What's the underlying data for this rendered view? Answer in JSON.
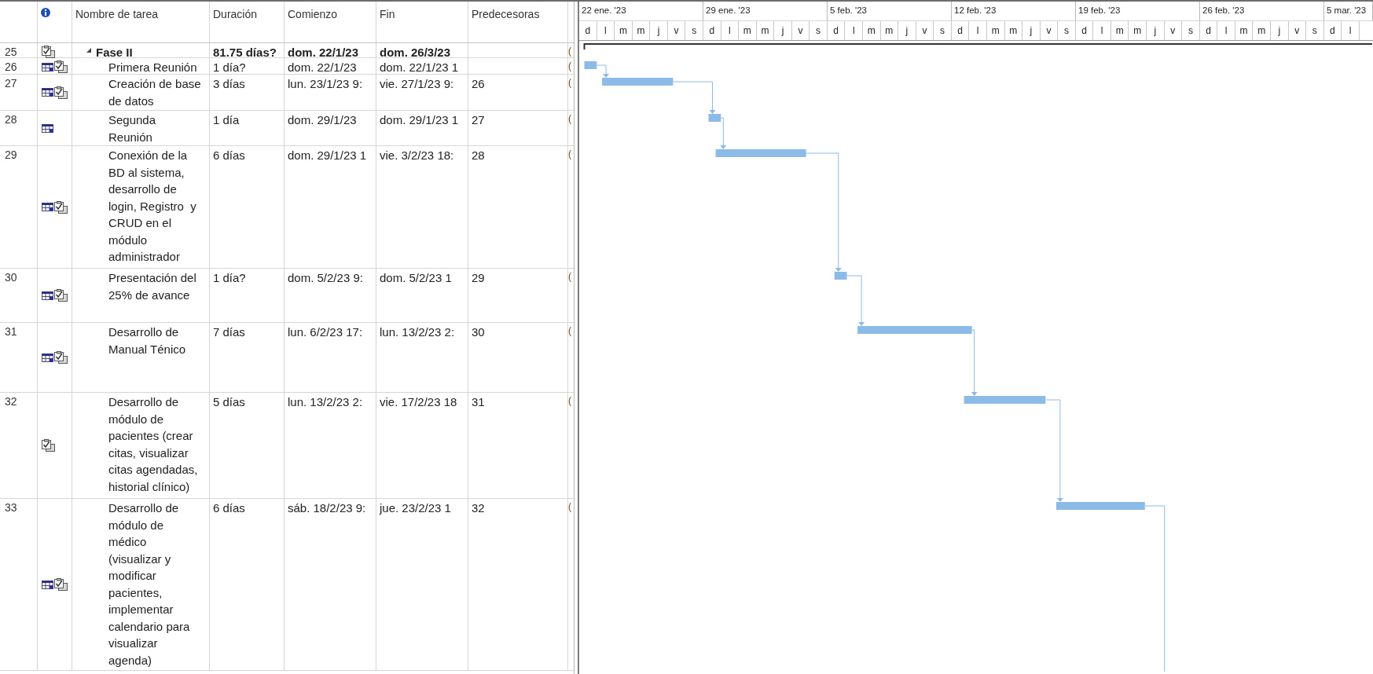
{
  "columns": [
    "Nombre de tarea",
    "Duración",
    "Comienzo",
    "Fin",
    "Predecesoras"
  ],
  "tasks": [
    {
      "id": "25",
      "name": "Fase II",
      "duracion": "81.75 días?",
      "comienzo": "dom. 22/1/23",
      "fin": "dom. 26/3/23",
      "column_8": "(",
      "calendar": false,
      "checkmark": true,
      "expanded": true,
      "children": [
        {
          "id": "26",
          "name": "Primera Reunión",
          "duracion": "1 día?",
          "comienzo": "dom. 22/1/23",
          "fin": "dom. 22/1/23 1",
          "column_8": "(",
          "calendar": true,
          "checkmark": true
        },
        {
          "id": "27",
          "name": "Creación de base de datos",
          "duracion": "3 días",
          "comienzo": "lun. 23/1/23 9:",
          "fin": "vie. 27/1/23 9:",
          "predecesoras": "26",
          "column_8": "(",
          "calendar": true,
          "checkmark": true
        },
        {
          "id": "28",
          "name": "Segunda Reunión",
          "duracion": "1 día",
          "comienzo": "dom. 29/1/23",
          "fin": "dom. 29/1/23 1",
          "predecesoras": "27",
          "column_8": "(",
          "calendar": true,
          "checkmark": false
        },
        {
          "id": "29",
          "name": "Conexión de la BD al sistema, desarrollo de login, Registro  y CRUD en el módulo administrador",
          "duracion": "6 días",
          "comienzo": "dom. 29/1/23 1",
          "fin": "vie. 3/2/23 18:",
          "predecesoras": "28",
          "column_8": "(",
          "calendar": true,
          "checkmark": true
        },
        {
          "id": "30",
          "name": "Presentación del 25% de avance",
          "duracion": "1 día?",
          "comienzo": "dom. 5/2/23 9:",
          "fin": "dom. 5/2/23 1",
          "predecesoras": "29",
          "column_8": "(",
          "calendar": true,
          "checkmark": true
        },
        {
          "id": "31",
          "name": "Desarrollo de Manual Ténico",
          "duracion": "7 días",
          "comienzo": "lun. 6/2/23 17:",
          "fin": "lun. 13/2/23 2:",
          "predecesoras": "30",
          "column_8": "(",
          "calendar": true,
          "checkmark": true
        },
        {
          "id": "32",
          "name": "Desarrollo de módulo de pacientes (crear citas, visualizar citas agendadas, historial clínico)",
          "duracion": "5 días",
          "comienzo": "lun. 13/2/23 2:",
          "fin": "vie. 17/2/23 18",
          "predecesoras": "31",
          "column_8": "(",
          "calendar": false,
          "checkmark": true
        },
        {
          "id": "33",
          "name": "Desarrollo de módulo de médico (visualizar y modificar pacientes, implementar calendario para visualizar agenda)",
          "duracion": "6 días",
          "comienzo": "sáb. 18/2/23 9:",
          "fin": "jue. 23/2/23 1",
          "predecesoras": "32",
          "column_8": "(",
          "calendar": true,
          "checkmark": true
        }
      ]
    }
  ],
  "timescale": [
    {
      "label": "22 ene. '23",
      "days": [
        "d",
        "l",
        "m",
        "m",
        "j",
        "v",
        "s"
      ]
    },
    {
      "label": "29 ene. '23",
      "days": [
        "d",
        "l",
        "m",
        "m",
        "j",
        "v",
        "s"
      ]
    },
    {
      "label": "5 feb. '23",
      "days": [
        "d",
        "l",
        "m",
        "m",
        "j",
        "v",
        "s"
      ]
    },
    {
      "label": "12 feb. '23",
      "days": [
        "d",
        "l",
        "m",
        "m",
        "j",
        "v",
        "s"
      ]
    },
    {
      "label": "19 feb. '23",
      "days": [
        "d",
        "l",
        "m",
        "m",
        "j",
        "v",
        "s"
      ]
    },
    {
      "label": "26 feb. '23",
      "days": [
        "d",
        "l",
        "m",
        "m",
        "j",
        "v",
        "s"
      ]
    },
    {
      "label": "5 mar. '23",
      "days": [
        "d",
        "l"
      ]
    }
  ]
}
